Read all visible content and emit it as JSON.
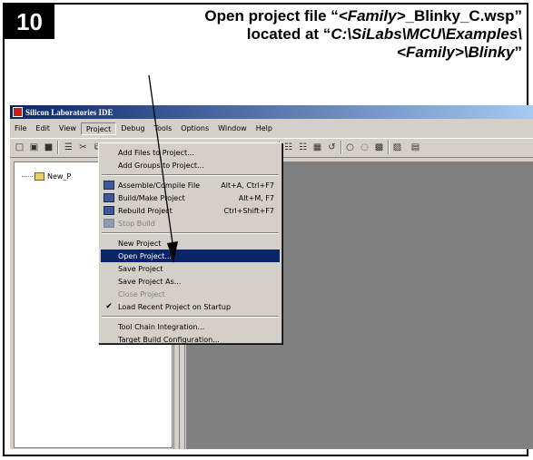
{
  "step": {
    "number": "10"
  },
  "caption": {
    "parts": [
      "Open project file “",
      "<Family>",
      "_Blinky_C.wsp”",
      "located at “",
      "C:\\SiLabs\\MCU\\Examples\\",
      "<Family>\\Blinky",
      "”"
    ]
  },
  "ide": {
    "title": "Silicon Laboratories IDE",
    "menu": [
      "File",
      "Edit",
      "View",
      "Project",
      "Debug",
      "Tools",
      "Options",
      "Window",
      "Help"
    ],
    "active_menu": "Project",
    "toolbar_icons": [
      "new-file-icon",
      "open-folder-icon",
      "save-icon",
      "toolbar-icon",
      "toolbar-icon",
      "toolbar-icon",
      "toolbar-icon",
      "toolbar-icon",
      "toolbar-icon",
      "toolbar-icon",
      "toolbar-icon",
      "toolbar-icon",
      "toolbar-icon",
      "toolbar-icon",
      "toolbar-icon"
    ],
    "tree_item": "New_P",
    "project_menu": [
      {
        "label": "Add Files to Project...",
        "shortcut": "",
        "icon": "",
        "state": "normal"
      },
      {
        "label": "Add Groups to Project...",
        "shortcut": "",
        "icon": "",
        "state": "normal"
      },
      {
        "separator": true
      },
      {
        "label": "Assemble/Compile File",
        "shortcut": "Alt+A, Ctrl+F7",
        "icon": "compile-icon",
        "state": "normal"
      },
      {
        "label": "Build/Make Project",
        "shortcut": "Alt+M, F7",
        "icon": "build-icon",
        "state": "normal"
      },
      {
        "label": "Rebuild Project",
        "shortcut": "Ctrl+Shift+F7",
        "icon": "rebuild-icon",
        "state": "normal"
      },
      {
        "label": "Stop Build",
        "shortcut": "",
        "icon": "stop-build-icon",
        "state": "disabled"
      },
      {
        "separator": true
      },
      {
        "label": "New Project",
        "shortcut": "",
        "icon": "",
        "state": "normal"
      },
      {
        "label": "Open Project...",
        "shortcut": "",
        "icon": "",
        "state": "selected"
      },
      {
        "label": "Save Project",
        "shortcut": "",
        "icon": "",
        "state": "normal"
      },
      {
        "label": "Save Project As...",
        "shortcut": "",
        "icon": "",
        "state": "normal"
      },
      {
        "label": "Close Project",
        "shortcut": "",
        "icon": "",
        "state": "disabled"
      },
      {
        "label": "Load Recent Project on Startup",
        "shortcut": "",
        "icon": "check-icon",
        "state": "checked"
      },
      {
        "separator": true
      },
      {
        "label": "Tool Chain Integration...",
        "shortcut": "",
        "icon": "",
        "state": "normal"
      },
      {
        "label": "Target Build Configuration...",
        "shortcut": "",
        "icon": "",
        "state": "normal"
      }
    ]
  }
}
